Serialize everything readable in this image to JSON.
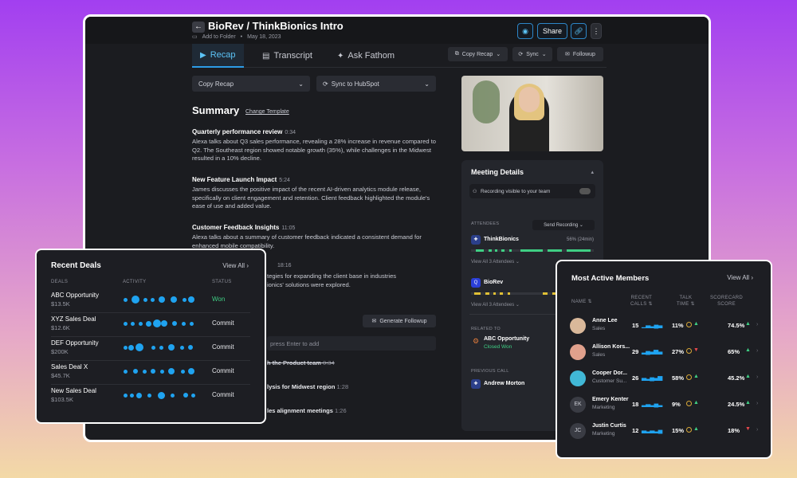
{
  "header": {
    "title": "BioRev / ThinkBionics Intro",
    "add_to_folder": "Add to Folder",
    "date": "May 18, 2023",
    "share_label": "Share"
  },
  "tabs": [
    {
      "label": "Recap"
    },
    {
      "label": "Transcript"
    },
    {
      "label": "Ask Fathom"
    }
  ],
  "controls": {
    "copy_recap_small": "Copy Recap",
    "sync_small": "Sync",
    "followup_small": "Followup",
    "copy_recap": "Copy Recap",
    "sync_hubspot": "Sync to HubSpot"
  },
  "summary": {
    "title": "Summary",
    "change_template": "Change Template",
    "sections": [
      {
        "title": "Quarterly performance review",
        "time": "0:34",
        "body": "Alexa talks about Q3 sales performance, revealing a 28% increase in revenue compared to Q2. The Southeast region showed notable growth (35%), while challenges in the Midwest resulted in a 10% decline."
      },
      {
        "title": "New Feature Launch Impact",
        "time": "5:24",
        "body": "James discusses the positive impact of the recent AI-driven analytics module release, specifically on client engagement and retention. Client feedback highlighted the module's ease of use and added value."
      },
      {
        "title": "Customer Feedback Insights",
        "time": "11:05",
        "body": "Alexa talks about a summary of customer feedback indicated a consistent demand for enhanced mobile compatibility."
      }
    ],
    "partial_time": "18:16",
    "partial_text_1": "tegies for expanding the client base in industries",
    "partial_text_2": "ionics' solutions were explored.",
    "generate_followup": "Generate Followup",
    "enter_hint": "press Enter to add",
    "action_1": "h the Product team",
    "action_1_time": "0:34",
    "action_2": "lysis for Midwest region",
    "action_2_time": "1:28",
    "action_3": "les alignment meetings",
    "action_3_time": "1:26"
  },
  "meeting": {
    "title": "Meeting Details",
    "recording_visible": "Recording visible to your team",
    "attendees_label": "ATTENDEES",
    "send_recording": "Send Recording",
    "company_1": "ThinkBionics",
    "company_1_stat": "56% (24min)",
    "view_attendees_1": "View All 3 Attendees",
    "company_2": "BioRev",
    "view_attendees_2": "View All 3 Attendees",
    "related_label": "RELATED TO",
    "related_deal": "ABC Opportunity",
    "related_status": "Closed Won",
    "previous_label": "PREVIOUS CALL",
    "previous_name": "Andrew Morton"
  },
  "recent_deals": {
    "title": "Recent Deals",
    "view_all": "View All",
    "col_deals": "DEALS",
    "col_activity": "ACTIVITY",
    "col_status": "STATUS",
    "rows": [
      {
        "name": "ABC Opportunity",
        "value": "$13.5K",
        "status": "Won"
      },
      {
        "name": "XYZ Sales Deal",
        "value": "$12.6K",
        "status": "Commit"
      },
      {
        "name": "DEF Opportunity",
        "value": "$200K",
        "status": "Commit"
      },
      {
        "name": "Sales Deal X",
        "value": "$45.7K",
        "status": "Commit"
      },
      {
        "name": "New Sales Deal",
        "value": "$103.5K",
        "status": "Commit"
      }
    ]
  },
  "members": {
    "title": "Most Active Members",
    "view_all": "View All",
    "col_name": "NAME",
    "col_calls_1": "RECENT",
    "col_calls_2": "CALLS",
    "col_talk_1": "TALK",
    "col_talk_2": "TIME",
    "col_score_1": "SCORECARD",
    "col_score_2": "SCORE",
    "rows": [
      {
        "name": "Anne Lee",
        "role": "Sales",
        "calls": "15",
        "talk": "11%",
        "score": "74.5%",
        "initials": ""
      },
      {
        "name": "Allison Kors...",
        "role": "Sales",
        "calls": "29",
        "talk": "27%",
        "score": "65%",
        "initials": ""
      },
      {
        "name": "Cooper Dor...",
        "role": "Customer Su...",
        "calls": "26",
        "talk": "58%",
        "score": "45.2%",
        "initials": ""
      },
      {
        "name": "Emery Kenter",
        "role": "Marketing",
        "calls": "18",
        "talk": "9%",
        "score": "24.5%",
        "initials": "EK"
      },
      {
        "name": "Justin Curtis",
        "role": "Marketing",
        "calls": "12",
        "talk": "15%",
        "score": "18%",
        "initials": "JC"
      }
    ]
  },
  "colors": {
    "accent": "#1fa3f0",
    "success": "#3fcf84",
    "warning": "#e0c035",
    "danger": "#e5484d"
  }
}
